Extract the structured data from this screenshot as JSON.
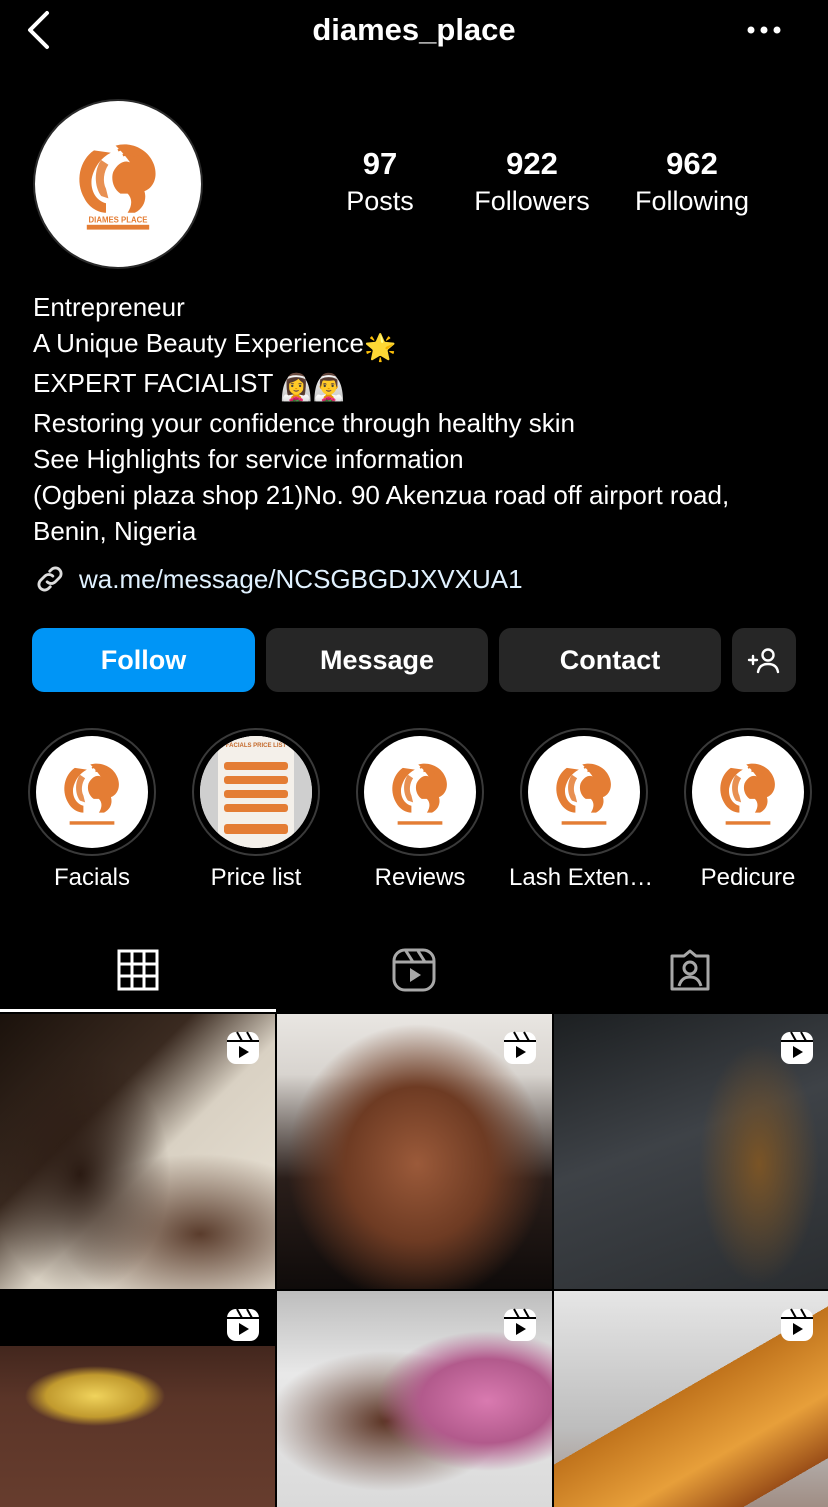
{
  "header": {
    "username": "diames_place",
    "back_icon": "chevron-left-icon",
    "more_icon": "more-horizontal-icon"
  },
  "profile": {
    "avatar_brand_text": "DIAMES PLACE",
    "stats": [
      {
        "value": "97",
        "label": "Posts"
      },
      {
        "value": "922",
        "label": "Followers"
      },
      {
        "value": "962",
        "label": "Following"
      }
    ],
    "bio": {
      "line1": "Entrepreneur",
      "line2": "A Unique Beauty Experience",
      "line2_emoji": "🌟",
      "line3": "EXPERT FACIALIST",
      "line3_emoji": "👰‍♀️👰‍♂️",
      "line4": "Restoring your confidence through healthy skin",
      "line5": "See Highlights for service information",
      "line6": "(Ogbeni plaza shop 21)No. 90 Akenzua road off airport road, Benin, Nigeria"
    },
    "link": {
      "icon": "link-icon",
      "text": "wa.me/message/NCSGBGDJXVXUA1"
    }
  },
  "actions": {
    "follow": "Follow",
    "message": "Message",
    "contact": "Contact",
    "suggest_icon": "add-person-icon"
  },
  "highlights": [
    {
      "label": "Facials"
    },
    {
      "label": "Price list",
      "preview_title": "FACIALS PRICE LIST"
    },
    {
      "label": "Reviews"
    },
    {
      "label": "Lash Extens..."
    },
    {
      "label": "Pedicure"
    }
  ],
  "tabs": [
    {
      "icon": "grid-icon",
      "active": true
    },
    {
      "icon": "reels-icon",
      "active": false
    },
    {
      "icon": "tagged-icon",
      "active": false
    }
  ],
  "posts": [
    {
      "type": "reel"
    },
    {
      "type": "reel"
    },
    {
      "type": "reel"
    },
    {
      "type": "reel"
    },
    {
      "type": "reel"
    },
    {
      "type": "reel"
    }
  ],
  "colors": {
    "background": "#000000",
    "follow_button": "#0095f6",
    "secondary_button": "#262626",
    "brand_orange": "#e47d34"
  }
}
